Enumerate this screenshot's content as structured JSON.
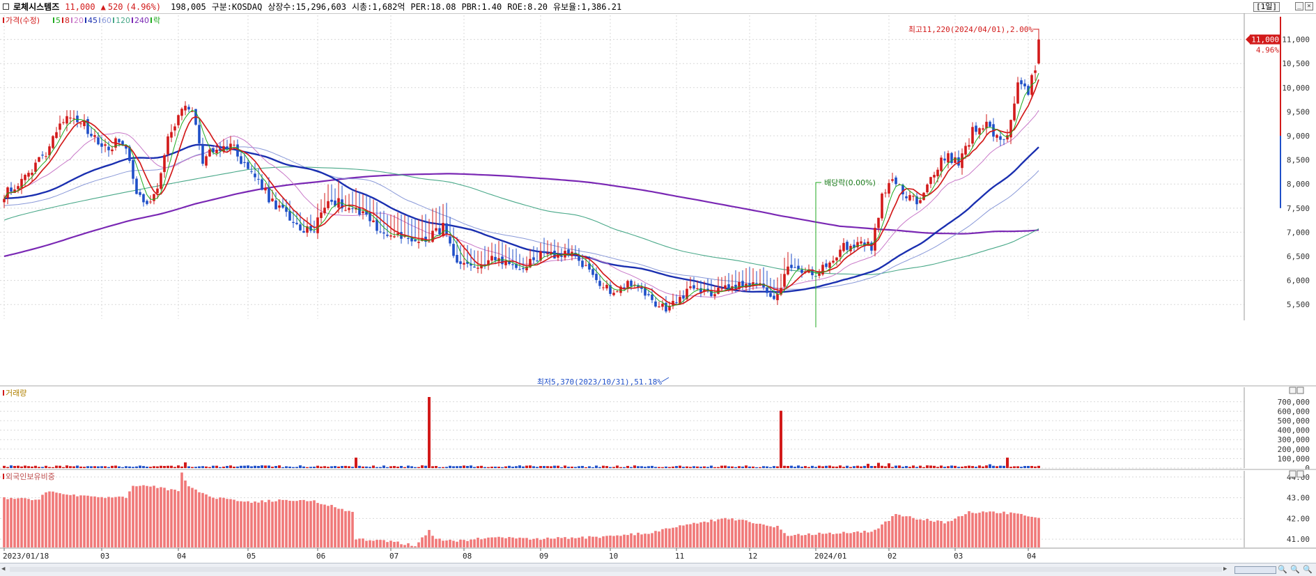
{
  "header": {
    "stock_name": "로체시스템즈",
    "price": "11,000",
    "change_arrow": "▲",
    "change": "520",
    "change_pct": "(4.96%)",
    "volume": "198,005",
    "market": "구분:KOSDAQ",
    "shares": "상장수:15,296,603",
    "mcap": "시총:1,682억",
    "per": "PER:18.08",
    "pbr": "PBR:1.40",
    "roe": "ROE:8.20",
    "retention": "유보율:1,386.21",
    "period": "[1일]"
  },
  "colors": {
    "up": "#d21a1a",
    "down": "#1f4fc8",
    "ma5": "#1faa1f",
    "ma8": "#d21a1a",
    "ma20": "#c878c8",
    "ma45": "#1a2fb0",
    "ma60": "#8898d8",
    "ma120": "#48a888",
    "ma240": "#7a28b4",
    "foreign_bar": "#f07878",
    "grid": "#d8d8d8"
  },
  "chart_data": [
    {
      "type": "candlestick",
      "name": "price-chart",
      "legend": [
        {
          "label": "가격(수정)",
          "color": "#d21a1a"
        },
        {
          "label": "5",
          "color": "#1faa1f"
        },
        {
          "label": "8",
          "color": "#d21a1a"
        },
        {
          "label": "20",
          "color": "#c878c8"
        },
        {
          "label": "45",
          "color": "#1a2fb0"
        },
        {
          "label": "60",
          "color": "#8898d8"
        },
        {
          "label": "120",
          "color": "#48a888"
        },
        {
          "label": "240",
          "color": "#7a28b4"
        },
        {
          "label": "락",
          "color": "#1faa1f"
        }
      ],
      "ylim": [
        5200,
        11500
      ],
      "y_ticks": [
        5500,
        6000,
        6500,
        7000,
        7500,
        8000,
        8500,
        9000,
        9500,
        10000,
        10500,
        11000
      ],
      "y_tick_labels": [
        "5,500",
        "6,000",
        "6,500",
        "7,000",
        "7,500",
        "8,000",
        "8,500",
        "9,000",
        "9,500",
        "10,000",
        "10,500",
        "11,000"
      ],
      "current_price_label": "11,000",
      "current_pct_label": "4.96%",
      "annotations": {
        "high": "최고11,220(2024/04/01),2.00%",
        "low": "최저5,370(2023/10/31),51.18%",
        "dividend": "배당락(0.00%)"
      },
      "anchor_points": [
        [
          0,
          7800
        ],
        [
          6,
          8100
        ],
        [
          12,
          8700
        ],
        [
          16,
          9300
        ],
        [
          20,
          9450
        ],
        [
          26,
          8900
        ],
        [
          30,
          8800
        ],
        [
          34,
          8900
        ],
        [
          38,
          7900
        ],
        [
          41,
          7550
        ],
        [
          44,
          8000
        ],
        [
          47,
          8900
        ],
        [
          51,
          9500
        ],
        [
          54,
          9550
        ],
        [
          57,
          8500
        ],
        [
          61,
          8700
        ],
        [
          65,
          8850
        ],
        [
          68,
          8500
        ],
        [
          72,
          8150
        ],
        [
          77,
          7600
        ],
        [
          81,
          7400
        ],
        [
          85,
          7000
        ],
        [
          89,
          7100
        ],
        [
          93,
          7700
        ],
        [
          98,
          7550
        ],
        [
          103,
          7450
        ],
        [
          108,
          7000
        ],
        [
          113,
          6900
        ],
        [
          118,
          6800
        ],
        [
          122,
          6900
        ],
        [
          126,
          7100
        ],
        [
          130,
          6300
        ],
        [
          134,
          6250
        ],
        [
          138,
          6400
        ],
        [
          142,
          6450
        ],
        [
          146,
          6300
        ],
        [
          150,
          6300
        ],
        [
          155,
          6600
        ],
        [
          159,
          6500
        ],
        [
          163,
          6550
        ],
        [
          167,
          6250
        ],
        [
          171,
          5950
        ],
        [
          175,
          5750
        ],
        [
          179,
          5950
        ],
        [
          183,
          5800
        ],
        [
          187,
          5500
        ],
        [
          190,
          5420
        ],
        [
          193,
          5600
        ],
        [
          198,
          5850
        ],
        [
          202,
          5720
        ],
        [
          207,
          5850
        ],
        [
          212,
          5900
        ],
        [
          217,
          5920
        ],
        [
          221,
          5550
        ],
        [
          225,
          6250
        ],
        [
          229,
          6150
        ],
        [
          233,
          6150
        ],
        [
          237,
          6400
        ],
        [
          241,
          6700
        ],
        [
          246,
          6750
        ],
        [
          249,
          6700
        ],
        [
          252,
          7700
        ],
        [
          255,
          8100
        ],
        [
          258,
          7800
        ],
        [
          262,
          7600
        ],
        [
          266,
          8050
        ],
        [
          270,
          8600
        ],
        [
          274,
          8400
        ],
        [
          278,
          9100
        ],
        [
          282,
          9300
        ],
        [
          285,
          8900
        ],
        [
          288,
          9000
        ],
        [
          291,
          10000
        ],
        [
          294,
          9900
        ],
        [
          296,
          10400
        ],
        [
          297,
          11000
        ]
      ],
      "y_extra_up": [
        [
          0,
          0
        ],
        [
          40,
          0
        ],
        [
          61,
          0
        ],
        [
          120,
          400
        ],
        [
          180,
          0
        ],
        [
          224,
          300
        ],
        [
          230,
          0
        ],
        [
          296,
          0
        ],
        [
          297,
          220
        ]
      ],
      "ma_lines": [
        "ma5",
        "ma8",
        "ma20",
        "ma45",
        "ma60",
        "ma120",
        "ma240"
      ],
      "ma_ext": {
        "ma120": {
          "start": 7250,
          "peak_idx": 70,
          "peak": 8300
        },
        "ma240": {
          "start": 6500
        }
      },
      "events": {
        "dividend_idx": 233,
        "high_idx": 297,
        "low_idx": 190
      }
    },
    {
      "type": "bar",
      "name": "volume-chart",
      "legend": [
        {
          "label": "거래량",
          "color": "#d21a1a"
        }
      ],
      "ylim": [
        0,
        750000
      ],
      "y_ticks": [
        0,
        100000,
        200000,
        300000,
        400000,
        500000,
        600000,
        700000
      ],
      "y_tick_labels": [
        "0",
        "100,000",
        "200,000",
        "300,000",
        "400,000",
        "500,000",
        "600,000",
        "700,000"
      ],
      "spikes": [
        [
          122,
          750000
        ],
        [
          223,
          605000
        ],
        [
          101,
          110000
        ],
        [
          288,
          110000
        ],
        [
          52,
          60000
        ],
        [
          251,
          55000
        ],
        [
          254,
          50000
        ],
        [
          248,
          45000
        ],
        [
          283,
          40000
        ]
      ],
      "base_level": 22000
    },
    {
      "type": "bar",
      "name": "foreign-ownership-chart",
      "legend": [
        {
          "label": "외국인보유비중",
          "color": "#d21a1a"
        }
      ],
      "ylim": [
        40.6,
        44.3
      ],
      "y_ticks": [
        41.0,
        42.0,
        43.0,
        44.0
      ],
      "y_tick_labels": [
        "41.00",
        "42.00",
        "43.00",
        "44.00"
      ],
      "anchor_points": [
        [
          0,
          43.0
        ],
        [
          10,
          42.9
        ],
        [
          12,
          43.3
        ],
        [
          20,
          43.1
        ],
        [
          35,
          43.0
        ],
        [
          37,
          43.6
        ],
        [
          45,
          43.5
        ],
        [
          50,
          43.3
        ],
        [
          51,
          44.2
        ],
        [
          53,
          43.5
        ],
        [
          60,
          43.0
        ],
        [
          70,
          42.8
        ],
        [
          85,
          42.9
        ],
        [
          90,
          42.8
        ],
        [
          100,
          42.3
        ],
        [
          101,
          41.0
        ],
        [
          110,
          40.9
        ],
        [
          118,
          40.7
        ],
        [
          122,
          41.4
        ],
        [
          124,
          41.0
        ],
        [
          130,
          40.9
        ],
        [
          140,
          41.1
        ],
        [
          150,
          41.0
        ],
        [
          170,
          41.1
        ],
        [
          185,
          41.3
        ],
        [
          195,
          41.7
        ],
        [
          208,
          42.0
        ],
        [
          215,
          41.8
        ],
        [
          222,
          41.6
        ],
        [
          225,
          41.2
        ],
        [
          240,
          41.3
        ],
        [
          250,
          41.4
        ],
        [
          256,
          42.2
        ],
        [
          262,
          42.0
        ],
        [
          270,
          41.8
        ],
        [
          277,
          42.3
        ],
        [
          285,
          42.3
        ],
        [
          292,
          42.2
        ],
        [
          297,
          42.0
        ]
      ]
    }
  ],
  "x_axis": {
    "labels": [
      {
        "idx": 0,
        "label": "2023/01/18"
      },
      {
        "idx": 28,
        "label": "03"
      },
      {
        "idx": 50,
        "label": "04"
      },
      {
        "idx": 70,
        "label": "05"
      },
      {
        "idx": 90,
        "label": "06"
      },
      {
        "idx": 111,
        "label": "07"
      },
      {
        "idx": 132,
        "label": "08"
      },
      {
        "idx": 154,
        "label": "09"
      },
      {
        "idx": 174,
        "label": "10"
      },
      {
        "idx": 193,
        "label": "11"
      },
      {
        "idx": 214,
        "label": "12"
      },
      {
        "idx": 233,
        "label": "2024/01"
      },
      {
        "idx": 254,
        "label": "02"
      },
      {
        "idx": 273,
        "label": "03"
      },
      {
        "idx": 294,
        "label": "04"
      }
    ]
  },
  "footer": {
    "zoom_in": "🔍",
    "zoom_out": "🔍",
    "zoom_reset": "🔍"
  }
}
